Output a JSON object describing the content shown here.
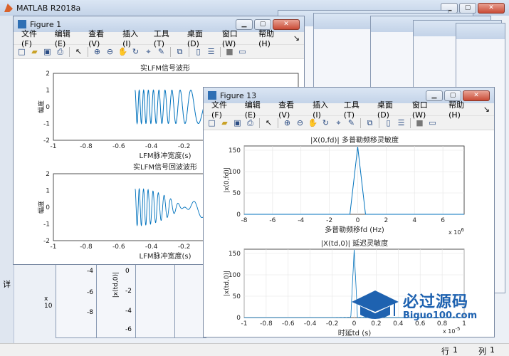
{
  "app": {
    "title": "MATLAB R2018a"
  },
  "menu": {
    "file": "文件(F)",
    "edit": "编辑(E)",
    "view": "查看(V)",
    "insert": "插入(I)",
    "tools": "工具(T)",
    "desktop": "桌面(D)",
    "window": "窗口(W)",
    "help": "帮助(H)"
  },
  "fig1": {
    "title": "Figure 1",
    "plot1": {
      "title": "实LFM信号波形",
      "xlabel": "LFM脉冲宽度(s)",
      "ylabel": "幅度",
      "xticks": [
        "-1",
        "-0.8",
        "-0.6",
        "-0.4",
        "-0.2",
        "0",
        "0.2",
        "0.4"
      ],
      "yticks": [
        "2",
        "1",
        "0",
        "-1",
        "-2"
      ]
    },
    "plot2": {
      "title": "实LFM信号回波波形",
      "xlabel": "LFM脉冲宽度(s)",
      "ylabel": "幅度",
      "xticks": [
        "-1",
        "-0.8",
        "-0.6",
        "-0.4",
        "-0.2",
        "0",
        "0.2",
        "0.4"
      ],
      "yticks": [
        "2",
        "1",
        "0",
        "-1",
        "-2"
      ]
    }
  },
  "fig13": {
    "title": "Figure 13",
    "plot1": {
      "title": "|X(0,fd)| 多普勒频移灵敏度",
      "xlabel": "多普勒频移fd (Hz)",
      "ylabel": "|x(0,fd)|",
      "xticks": [
        "-8",
        "-6",
        "-4",
        "-2",
        "0",
        "2",
        "4",
        "6"
      ],
      "yticks": [
        "150",
        "100",
        "50",
        "0"
      ],
      "exp": "10",
      "exp_power": "6"
    },
    "plot2": {
      "title": "|X(td,0)| 延迟灵敏度",
      "xlabel": "时延td (s)",
      "ylabel": "|x(td,0)|",
      "xticks": [
        "-1",
        "-0.8",
        "-0.6",
        "-0.4",
        "-0.2",
        "0",
        "0.2",
        "0.4",
        "0.6",
        "0.8",
        "1"
      ],
      "yticks": [
        "150",
        "100",
        "50",
        "0"
      ],
      "exp": "10",
      "exp_power": "-5"
    }
  },
  "background_fragments": {
    "ticks_a": [
      "-4",
      "-6",
      "-8"
    ],
    "ticks_b": [
      "0",
      "-2",
      "-4",
      "-6",
      "-8"
    ],
    "label_a": "|x(td,0)|",
    "label_b": "x 10",
    "label_c": "详"
  },
  "watermark": {
    "main": "必过源码",
    "sub": "Biguo100.com"
  },
  "status": {
    "row_label": "行",
    "row_value": "1",
    "col_label": "列",
    "col_value": "1"
  },
  "colors": {
    "line": "#0072bd",
    "accent": "#2e6fb4"
  }
}
